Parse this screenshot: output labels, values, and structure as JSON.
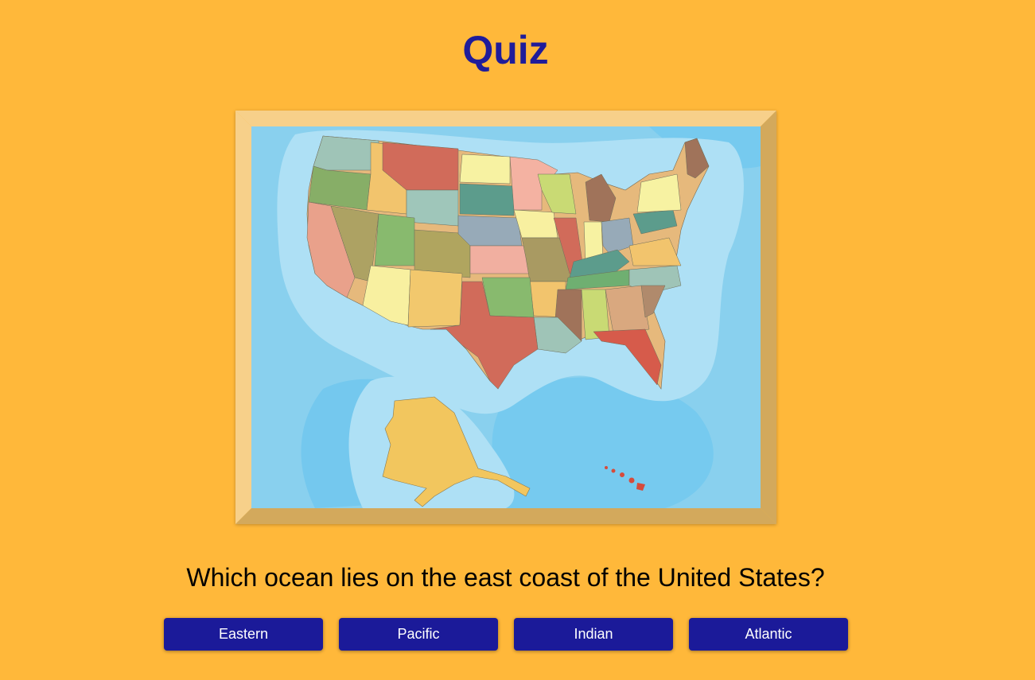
{
  "title": "Quiz",
  "question": "Which ocean lies on the east coast of the United States?",
  "answers": [
    "Eastern",
    "Pacific",
    "Indian",
    "Atlantic"
  ],
  "map_image": "map of the United States",
  "colors": {
    "background": "#FFB83A",
    "title": "#1F1C9A",
    "button": "#1B1A99",
    "button_text": "#FFFFFF",
    "ocean": "#7BCFF0",
    "shallow_water": "#AEE0F5",
    "frame_light": "#F7D08A",
    "frame_dark": "#D3A95C"
  }
}
